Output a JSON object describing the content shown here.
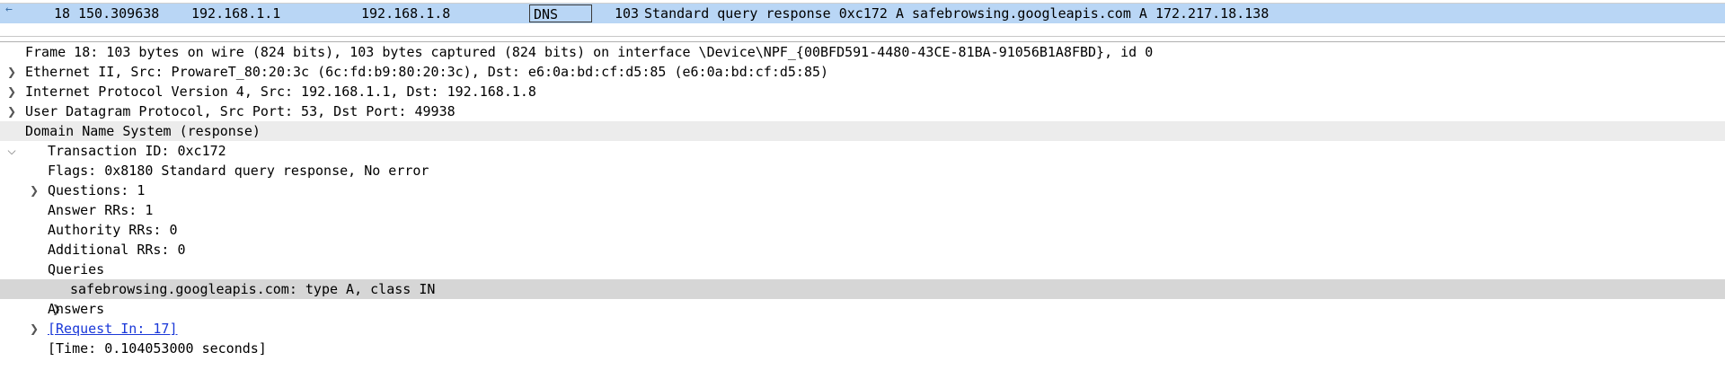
{
  "packet_list": {
    "row": {
      "no": "18",
      "time": "150.309638",
      "source": "192.168.1.1",
      "destination": "192.168.1.8",
      "protocol": "DNS",
      "length": "103",
      "info": "Standard query response 0xc172 A safebrowsing.googleapis.com A 172.217.18.138"
    },
    "selected_row_color": "#b9d6f5"
  },
  "details": {
    "frame": "Frame 18: 103 bytes on wire (824 bits), 103 bytes captured (824 bits) on interface \\Device\\NPF_{00BFD591-4480-43CE-81BA-91056B1A8FBD}, id 0",
    "ethernet": "Ethernet II, Src: ProwareT_80:20:3c (6c:fd:b9:80:20:3c), Dst: e6:0a:bd:cf:d5:85 (e6:0a:bd:cf:d5:85)",
    "ip": "Internet Protocol Version 4, Src: 192.168.1.1, Dst: 192.168.1.8",
    "udp": "User Datagram Protocol, Src Port: 53, Dst Port: 49938",
    "dns": "Domain Name System (response)",
    "transaction_id": "Transaction ID: 0xc172",
    "flags": "Flags: 0x8180 Standard query response, No error",
    "questions": "Questions: 1",
    "answer_rrs": "Answer RRs: 1",
    "authority_rrs": "Authority RRs: 0",
    "additional_rrs": "Additional RRs: 0",
    "queries": "Queries",
    "query_item": "safebrowsing.googleapis.com: type A, class IN",
    "answers": "Answers",
    "request_in": "[Request In: 17]",
    "time": "[Time: 0.104053000 seconds]"
  },
  "icons": {
    "collapsed": "chevron-right-icon",
    "expanded": "chevron-down-icon",
    "related_packet": "related-packet-arrow-icon"
  }
}
